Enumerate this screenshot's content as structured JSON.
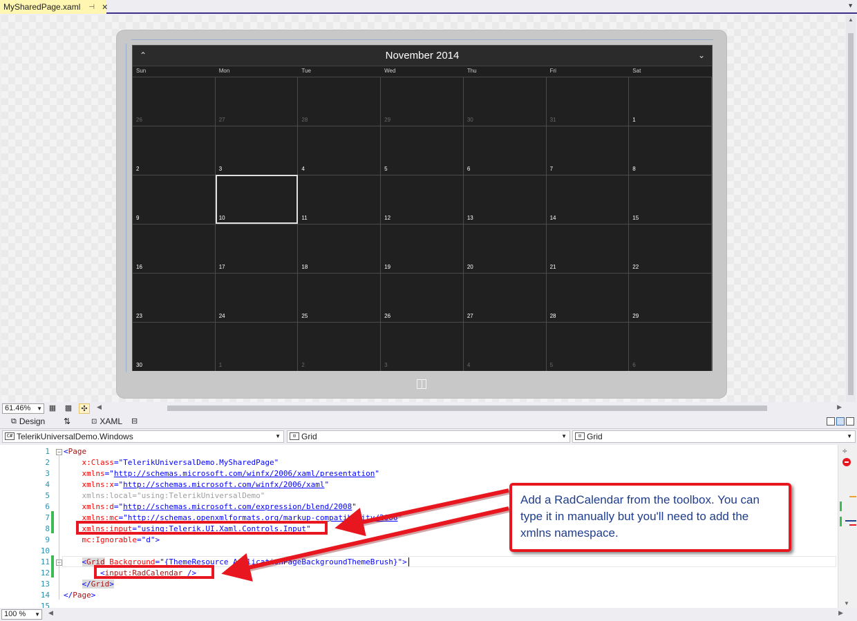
{
  "document_tab": {
    "title": "MySharedPage.xaml",
    "pin": "⊣",
    "close": "✕"
  },
  "calendar": {
    "title": "November 2014",
    "prev": "⌃",
    "next": "⌄",
    "days_of_week": [
      "Sun",
      "Mon",
      "Tue",
      "Wed",
      "Thu",
      "Fri",
      "Sat"
    ],
    "cells": [
      {
        "n": "26",
        "other": true
      },
      {
        "n": "27",
        "other": true
      },
      {
        "n": "28",
        "other": true
      },
      {
        "n": "29",
        "other": true
      },
      {
        "n": "30",
        "other": true
      },
      {
        "n": "31",
        "other": true
      },
      {
        "n": "1"
      },
      {
        "n": "2"
      },
      {
        "n": "3"
      },
      {
        "n": "4"
      },
      {
        "n": "5"
      },
      {
        "n": "6"
      },
      {
        "n": "7"
      },
      {
        "n": "8"
      },
      {
        "n": "9"
      },
      {
        "n": "10",
        "today": true
      },
      {
        "n": "11"
      },
      {
        "n": "12"
      },
      {
        "n": "13"
      },
      {
        "n": "14"
      },
      {
        "n": "15"
      },
      {
        "n": "16"
      },
      {
        "n": "17"
      },
      {
        "n": "18"
      },
      {
        "n": "19"
      },
      {
        "n": "20"
      },
      {
        "n": "21"
      },
      {
        "n": "22"
      },
      {
        "n": "23"
      },
      {
        "n": "24"
      },
      {
        "n": "25"
      },
      {
        "n": "26"
      },
      {
        "n": "27"
      },
      {
        "n": "28"
      },
      {
        "n": "29"
      },
      {
        "n": "30"
      },
      {
        "n": "1",
        "other": true
      },
      {
        "n": "2",
        "other": true
      },
      {
        "n": "3",
        "other": true
      },
      {
        "n": "4",
        "other": true
      },
      {
        "n": "5",
        "other": true
      },
      {
        "n": "6",
        "other": true
      }
    ]
  },
  "designer_toolbar": {
    "zoom": "61.46%"
  },
  "split_tabs": {
    "design": "Design",
    "swap": "⇅",
    "xaml": "XAML"
  },
  "nav": {
    "project": "TelerikUniversalDemo.Windows",
    "type": "Grid",
    "member": "Grid"
  },
  "code_lines": [
    {
      "n": "1",
      "tokens": [
        [
          "b",
          "<"
        ],
        [
          "m",
          "Page"
        ]
      ]
    },
    {
      "n": "2",
      "tokens": [
        [
          "t",
          "    "
        ],
        [
          "r",
          "x:Class"
        ],
        [
          "b",
          "="
        ],
        [
          "s",
          "\"TelerikUniversalDemo.MySharedPage\""
        ]
      ]
    },
    {
      "n": "3",
      "tokens": [
        [
          "t",
          "    "
        ],
        [
          "r",
          "xmlns"
        ],
        [
          "b",
          "="
        ],
        [
          "s",
          "\""
        ],
        [
          "u",
          "http://schemas.microsoft.com/winfx/2006/xaml/presentation"
        ],
        [
          "s",
          "\""
        ]
      ]
    },
    {
      "n": "4",
      "tokens": [
        [
          "t",
          "    "
        ],
        [
          "r",
          "xmlns:x"
        ],
        [
          "b",
          "="
        ],
        [
          "s",
          "\""
        ],
        [
          "u",
          "http://schemas.microsoft.com/winfx/2006/xaml"
        ],
        [
          "s",
          "\""
        ]
      ]
    },
    {
      "n": "5",
      "tokens": [
        [
          "t",
          "    "
        ],
        [
          "g",
          "xmlns:local"
        ],
        [
          "gs",
          "=\"using:TelerikUniversalDemo\""
        ]
      ]
    },
    {
      "n": "6",
      "tokens": [
        [
          "t",
          "    "
        ],
        [
          "r",
          "xmlns:d"
        ],
        [
          "b",
          "="
        ],
        [
          "s",
          "\""
        ],
        [
          "u",
          "http://schemas.microsoft.com/expression/blend/2008"
        ],
        [
          "s",
          "\""
        ]
      ]
    },
    {
      "n": "7",
      "tokens": [
        [
          "t",
          "    "
        ],
        [
          "r",
          "xmlns:mc"
        ],
        [
          "b",
          "="
        ],
        [
          "s",
          "\""
        ],
        [
          "u",
          "http://schemas.openxmlformats.org/markup-compatibility/2006"
        ],
        [
          "s",
          "\""
        ]
      ]
    },
    {
      "n": "8",
      "tokens": [
        [
          "t",
          "    "
        ],
        [
          "r",
          "xmlns:input"
        ],
        [
          "b",
          "="
        ],
        [
          "s",
          "\"using:Telerik.UI.Xaml.Controls.Input\""
        ]
      ]
    },
    {
      "n": "9",
      "tokens": [
        [
          "t",
          "    "
        ],
        [
          "r",
          "mc:Ignorable"
        ],
        [
          "b",
          "="
        ],
        [
          "s",
          "\"d\""
        ],
        [
          "b",
          ">"
        ]
      ]
    },
    {
      "n": "10",
      "tokens": []
    },
    {
      "n": "11",
      "tokens": [
        [
          "t",
          "    "
        ],
        [
          "bh",
          "<"
        ],
        [
          "mh",
          "Grid"
        ],
        [
          "t",
          " "
        ],
        [
          "r",
          "Background"
        ],
        [
          "b",
          "="
        ],
        [
          "s",
          "\"{ThemeResource ApplicationPageBackgroundThemeBrush}\""
        ],
        [
          "b",
          ">"
        ]
      ]
    },
    {
      "n": "12",
      "tokens": [
        [
          "t",
          "        "
        ],
        [
          "b",
          "<"
        ],
        [
          "m",
          "input:RadCalendar"
        ],
        [
          "t",
          " "
        ],
        [
          "b",
          "/>"
        ]
      ]
    },
    {
      "n": "13",
      "tokens": [
        [
          "t",
          "    "
        ],
        [
          "bh",
          "</"
        ],
        [
          "mh",
          "Grid"
        ],
        [
          "bh",
          ">"
        ]
      ]
    },
    {
      "n": "14",
      "tokens": [
        [
          "b",
          "</"
        ],
        [
          "m",
          "Page"
        ],
        [
          "b",
          ">"
        ]
      ]
    },
    {
      "n": "15",
      "tokens": []
    }
  ],
  "callout_text": "Add a RadCalendar from the toolbox. You can type it in manually but you'll need to add the xmlns namespace.",
  "editor_zoom": "100 %",
  "colors": {
    "callout_border": "#e8171f",
    "callout_text": "#1f3d8c",
    "tab_active": "#fff7b1",
    "change_marker": "#3cba54"
  }
}
